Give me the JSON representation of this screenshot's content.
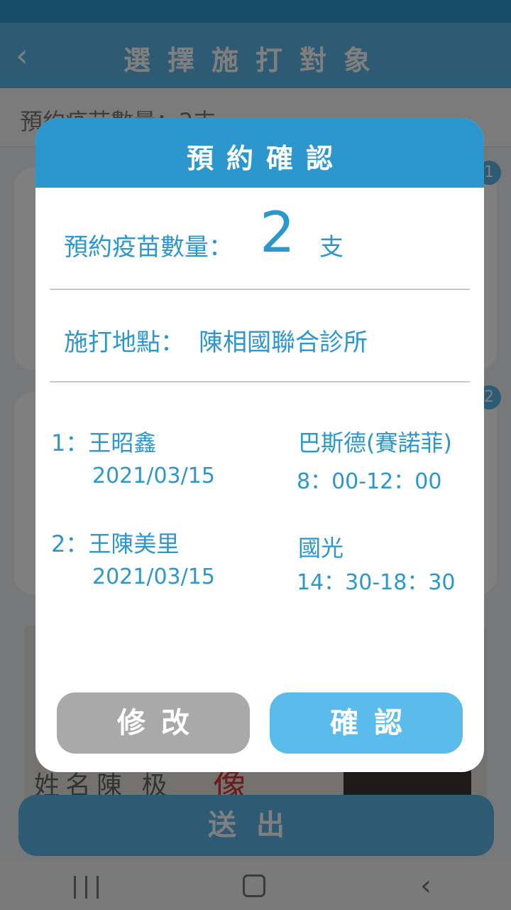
{
  "header": {
    "title": "選擇施打對象",
    "back_icon": "chevron-left-icon"
  },
  "summary": {
    "count_text": "預約疫苗數量：2支"
  },
  "cards": [
    {
      "badge": "1"
    },
    {
      "badge": "2"
    }
  ],
  "id_card": {
    "label": "姓名陳 极",
    "stamp": "像"
  },
  "submit": {
    "label": "送出"
  },
  "dialog": {
    "title": "預約確認",
    "quantity_label": "預約疫苗數量：",
    "quantity_value": "2",
    "quantity_unit": "支",
    "location_label": "施打地點：",
    "location_value": "陳相國聯合診所",
    "appointments": [
      {
        "name": "1：王昭鑫",
        "date": "2021/03/15",
        "vaccine": "巴斯德(賽諾菲)",
        "time": "8：00-12：00"
      },
      {
        "name": "2：王陳美里",
        "date": "2021/03/15",
        "vaccine": "國光",
        "time": "14：30-18：30"
      }
    ],
    "modify_label": "修改",
    "confirm_label": "確認"
  },
  "colors": {
    "primary": "#2b97cc",
    "accent": "#5ab6e6",
    "disabled": "#a9a9a9"
  }
}
